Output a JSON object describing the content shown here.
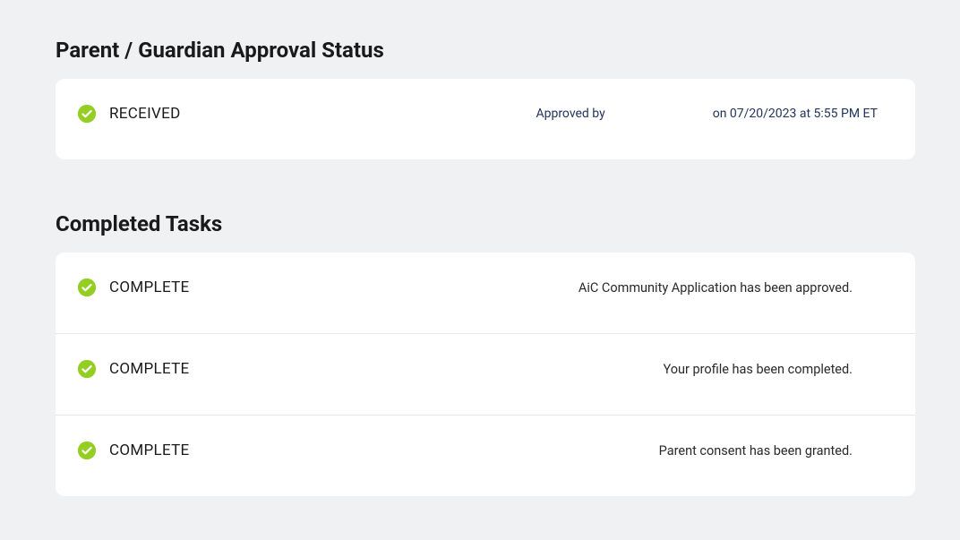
{
  "approval": {
    "section_title": "Parent / Guardian Approval Status",
    "status_label": "RECEIVED",
    "approved_by_label": "Approved by",
    "timestamp": "on 07/20/2023 at 5:55 PM ET"
  },
  "tasks": {
    "section_title": "Completed Tasks",
    "items": [
      {
        "status": "COMPLETE",
        "description": "AiC Community Application has been approved."
      },
      {
        "status": "COMPLETE",
        "description": "Your profile has been completed."
      },
      {
        "status": "COMPLETE",
        "description": "Parent consent has been granted."
      }
    ]
  },
  "colors": {
    "check_fill": "#94ce23",
    "check_inner": "#ffffff"
  }
}
